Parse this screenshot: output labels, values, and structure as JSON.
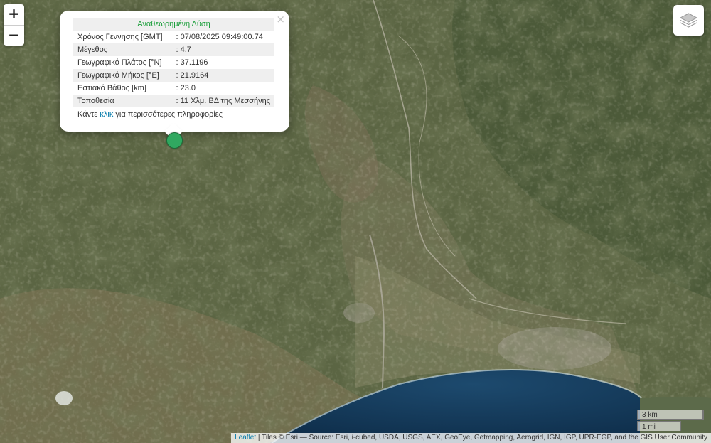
{
  "map": {
    "basemap": "satellite imagery",
    "sea_color": "#163c5c",
    "land_color": "#5a6444"
  },
  "controls": {
    "zoom_in": "+",
    "zoom_out": "−",
    "layers_icon": "layers-icon"
  },
  "popup": {
    "title": "Αναθεωρημένη Λύση",
    "close": "×",
    "rows": [
      {
        "label": "Χρόνος Γέννησης [GMT]",
        "value": ": 07/08/2025 09:49:00.74"
      },
      {
        "label": "Μέγεθος",
        "value": ": 4.7"
      },
      {
        "label": "Γεωγραφικό Πλάτος [°N]",
        "value": ": 37.1196"
      },
      {
        "label": "Γεωγραφικό Μήκος [°E]",
        "value": ": 21.9164"
      },
      {
        "label": "Εστιακό Βάθος [km]",
        "value": ": 23.0"
      },
      {
        "label": "Τοποθεσία",
        "value": ": 11 Χλμ. ΒΔ της Μεσσήνης"
      }
    ],
    "more_prefix": "Κάντε",
    "more_link": "κλικ",
    "more_suffix": "για περισσότερες πληροφορίες"
  },
  "marker": {
    "color": "#30a860"
  },
  "scale": {
    "km": "3 km",
    "mi": "1 mi"
  },
  "attribution": {
    "leaflet": "Leaflet",
    "text": " | Tiles © Esri — Source: Esri, i-cubed, USDA, USGS, AEX, GeoEye, Getmapping, Aerogrid, IGN, IGP, UPR-EGP, and the GIS User Community"
  }
}
